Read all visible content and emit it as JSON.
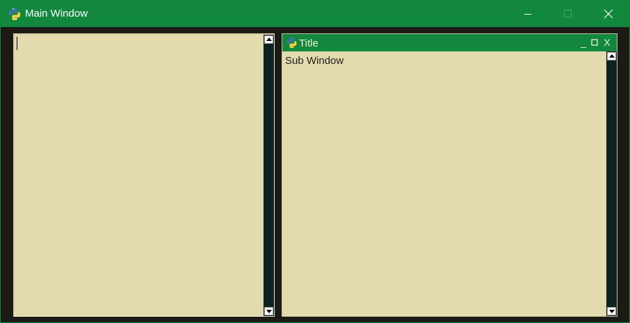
{
  "window": {
    "title": "Main Window",
    "icon": "python-logo-icon",
    "controls": {
      "minimize": "minimize-icon",
      "maximize": "maximize-icon",
      "close": "close-icon"
    }
  },
  "left_pane": {
    "text_value": ""
  },
  "sub_window": {
    "title": "Title",
    "icon": "python-logo-icon",
    "controls": {
      "minimize": "_",
      "maximize": "□",
      "close": "X"
    },
    "content_text": "Sub Window"
  },
  "colors": {
    "titlebar": "#12883f",
    "background": "#1b1a14",
    "text_area": "#e3dbad",
    "scrollbar_track": "#0c2322"
  }
}
